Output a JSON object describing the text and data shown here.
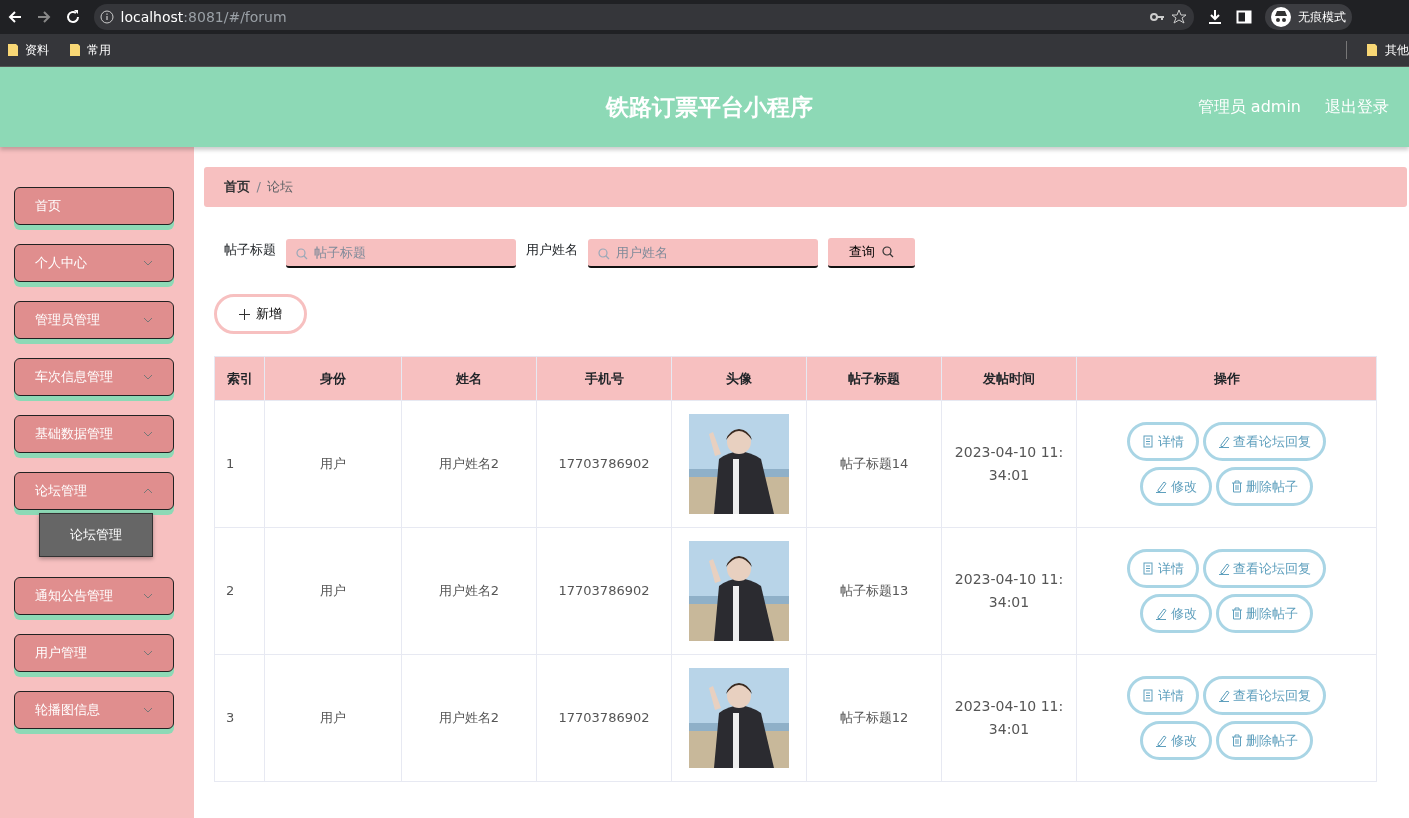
{
  "browser": {
    "url_host": "localhost",
    "url_rest": ":8081/#/forum",
    "profile": "无痕模式",
    "bookmarks": [
      "资料",
      "常用"
    ],
    "other_bookmarks": "其他"
  },
  "header": {
    "title": "铁路订票平台小程序",
    "user": "管理员 admin",
    "logout": "退出登录"
  },
  "sidebar": {
    "items": [
      {
        "label": "首页"
      },
      {
        "label": "个人中心",
        "expanded": false
      },
      {
        "label": "管理员管理",
        "expanded": false
      },
      {
        "label": "车次信息管理",
        "expanded": false
      },
      {
        "label": "基础数据管理",
        "expanded": false
      },
      {
        "label": "论坛管理",
        "expanded": true,
        "children": [
          {
            "label": "论坛管理",
            "selected": true
          }
        ]
      },
      {
        "label": "通知公告管理",
        "expanded": false
      },
      {
        "label": "用户管理",
        "expanded": false
      },
      {
        "label": "轮播图信息",
        "expanded": false
      }
    ]
  },
  "breadcrumb": {
    "items": [
      "首页",
      "论坛"
    ],
    "separator": "/"
  },
  "search": {
    "fields": [
      {
        "label": "帖子标题",
        "placeholder": "帖子标题"
      },
      {
        "label": "用户姓名",
        "placeholder": "用户姓名"
      }
    ],
    "button": "查询"
  },
  "add_button": "新增",
  "table": {
    "columns": [
      "索引",
      "身份",
      "姓名",
      "手机号",
      "头像",
      "帖子标题",
      "发帖时间",
      "操作"
    ],
    "rows": [
      {
        "cells": [
          "1",
          "用户",
          "用户姓名2",
          "17703786902",
          {
            "kind": "picture"
          },
          "帖子标题14",
          "2023-04-10 11:34:01"
        ],
        "actions": [
          {
            "kind": "detail",
            "label": "详情"
          },
          {
            "kind": "edit",
            "label": "查看论坛回复"
          },
          {
            "kind": "edit",
            "label": "修改"
          },
          {
            "kind": "delete",
            "label": "删除帖子"
          }
        ]
      },
      {
        "cells": [
          "2",
          "用户",
          "用户姓名2",
          "17703786902",
          {
            "kind": "picture"
          },
          "帖子标题13",
          "2023-04-10 11:34:01"
        ],
        "actions": [
          {
            "kind": "detail",
            "label": "详情"
          },
          {
            "kind": "edit",
            "label": "查看论坛回复"
          },
          {
            "kind": "edit",
            "label": "修改"
          },
          {
            "kind": "delete",
            "label": "删除帖子"
          }
        ]
      },
      {
        "cells": [
          "3",
          "用户",
          "用户姓名2",
          "17703786902",
          {
            "kind": "picture"
          },
          "帖子标题12",
          "2023-04-10 11:34:01"
        ],
        "actions": [
          {
            "kind": "detail",
            "label": "详情"
          },
          {
            "kind": "edit",
            "label": "查看论坛回复"
          },
          {
            "kind": "edit",
            "label": "修改"
          },
          {
            "kind": "delete",
            "label": "删除帖子"
          }
        ]
      }
    ]
  }
}
